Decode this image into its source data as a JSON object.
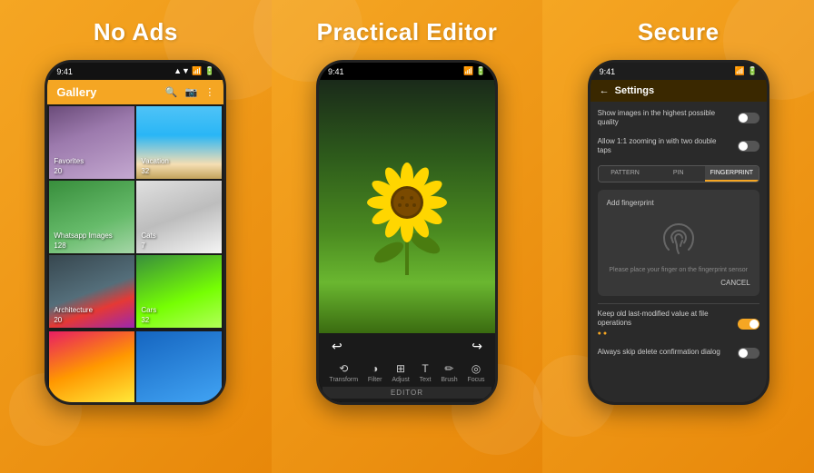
{
  "panels": [
    {
      "id": "no-ads",
      "title": "No Ads",
      "phone": {
        "status": "9:41",
        "header_title": "Gallery",
        "albums": [
          {
            "name": "Favorites",
            "count": "20",
            "photo": "woman"
          },
          {
            "name": "Vacation",
            "count": "32",
            "photo": "beach"
          },
          {
            "name": "Whatsapp Images",
            "count": "128",
            "photo": "plant"
          },
          {
            "name": "Cats",
            "count": "7",
            "photo": "cat"
          },
          {
            "name": "Architecture",
            "count": "20",
            "photo": "arch"
          },
          {
            "name": "Cars",
            "count": "32",
            "photo": "car"
          }
        ]
      }
    },
    {
      "id": "practical-editor",
      "title": "Practical Editor",
      "phone": {
        "status": "9:41",
        "tools": [
          "Transform",
          "Filter",
          "Adjust",
          "Text",
          "Brush",
          "Focus"
        ],
        "label": "EDITOR"
      }
    },
    {
      "id": "secure",
      "title": "Secure",
      "phone": {
        "status": "9:41",
        "header_title": "Settings",
        "settings": [
          "Show images in the highest possible quality",
          "Allow 1:1 zooming in with two double taps"
        ],
        "tabs": [
          "PATTERN",
          "PIN",
          "FINGERPRINT"
        ],
        "active_tab": 2,
        "fingerprint_title": "Add fingerprint",
        "fingerprint_hint": "Please place your finger on the fingerprint sensor",
        "cancel_label": "CANCEL",
        "extra_settings": [
          "Keep old last-modified value at file operations",
          "Always skip delete confirmation dialog"
        ]
      }
    }
  ]
}
